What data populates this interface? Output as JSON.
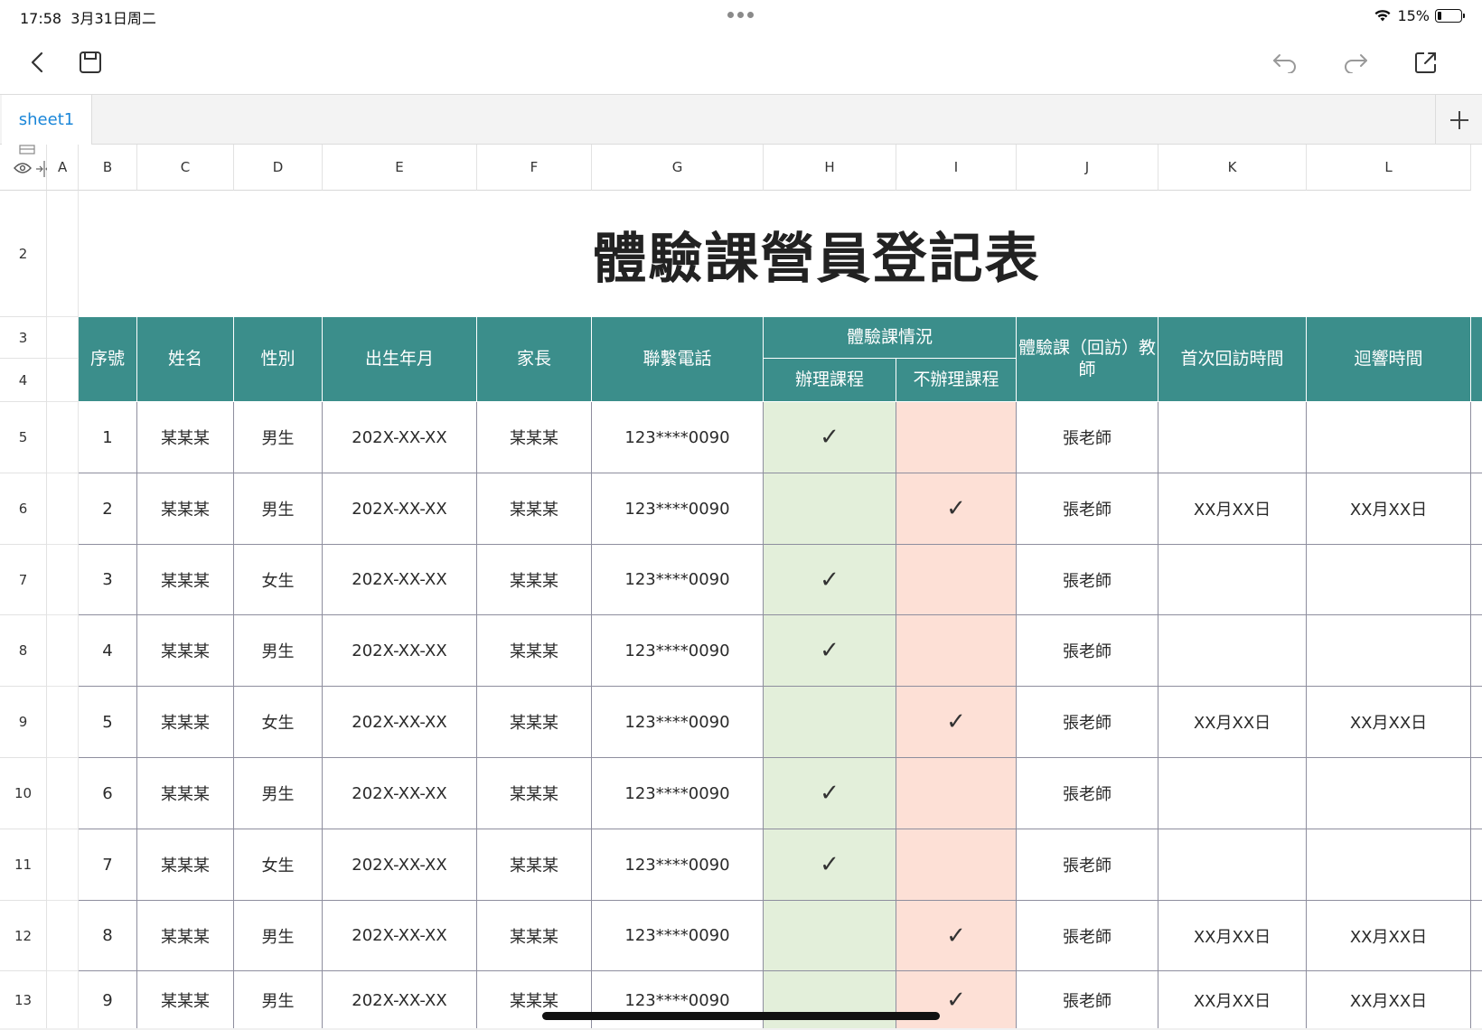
{
  "status_bar": {
    "time": "17:58",
    "date": "3月31日周二",
    "battery": "15%",
    "battery_level": 0.15
  },
  "toolbar": {
    "back_icon": "chevron-left-icon",
    "save_icon": "save-icon",
    "undo_icon": "undo-icon",
    "redo_icon": "redo-icon",
    "share_icon": "share-icon"
  },
  "sheet_tabs": [
    {
      "label": "sheet1",
      "active": true
    }
  ],
  "columns": [
    "A",
    "B",
    "C",
    "D",
    "E",
    "F",
    "G",
    "H",
    "I",
    "J",
    "K",
    "L"
  ],
  "rows": [
    "2",
    "3",
    "4",
    "5",
    "6",
    "7",
    "8",
    "9",
    "10",
    "11",
    "12",
    "13"
  ],
  "sheet": {
    "title": "體驗課營員登記表",
    "headers": {
      "seq": "序號",
      "name": "姓名",
      "gender": "性別",
      "birth": "出生年月",
      "parent": "家長",
      "phone": "聯繫電話",
      "trial_status": "體驗課情況",
      "enrolled": "辦理課程",
      "not_enrolled": "不辦理課程",
      "teacher": "體驗課（回訪）教師",
      "first_visit": "首次回訪時間",
      "response": "迴響時間"
    },
    "check_mark": "✓",
    "records": [
      {
        "seq": "1",
        "name": "某某某",
        "gender": "男生",
        "birth": "202X-XX-XX",
        "parent": "某某某",
        "phone": "123****0090",
        "enrolled": true,
        "teacher": "張老師",
        "first_visit": "",
        "response": ""
      },
      {
        "seq": "2",
        "name": "某某某",
        "gender": "男生",
        "birth": "202X-XX-XX",
        "parent": "某某某",
        "phone": "123****0090",
        "enrolled": false,
        "teacher": "張老師",
        "first_visit": "XX月XX日",
        "response": "XX月XX日"
      },
      {
        "seq": "3",
        "name": "某某某",
        "gender": "女生",
        "birth": "202X-XX-XX",
        "parent": "某某某",
        "phone": "123****0090",
        "enrolled": true,
        "teacher": "張老師",
        "first_visit": "",
        "response": ""
      },
      {
        "seq": "4",
        "name": "某某某",
        "gender": "男生",
        "birth": "202X-XX-XX",
        "parent": "某某某",
        "phone": "123****0090",
        "enrolled": true,
        "teacher": "張老師",
        "first_visit": "",
        "response": ""
      },
      {
        "seq": "5",
        "name": "某某某",
        "gender": "女生",
        "birth": "202X-XX-XX",
        "parent": "某某某",
        "phone": "123****0090",
        "enrolled": false,
        "teacher": "張老師",
        "first_visit": "XX月XX日",
        "response": "XX月XX日"
      },
      {
        "seq": "6",
        "name": "某某某",
        "gender": "男生",
        "birth": "202X-XX-XX",
        "parent": "某某某",
        "phone": "123****0090",
        "enrolled": true,
        "teacher": "張老師",
        "first_visit": "",
        "response": ""
      },
      {
        "seq": "7",
        "name": "某某某",
        "gender": "女生",
        "birth": "202X-XX-XX",
        "parent": "某某某",
        "phone": "123****0090",
        "enrolled": true,
        "teacher": "張老師",
        "first_visit": "",
        "response": ""
      },
      {
        "seq": "8",
        "name": "某某某",
        "gender": "男生",
        "birth": "202X-XX-XX",
        "parent": "某某某",
        "phone": "123****0090",
        "enrolled": false,
        "teacher": "張老師",
        "first_visit": "XX月XX日",
        "response": "XX月XX日"
      },
      {
        "seq": "9",
        "name": "某某某",
        "gender": "男生",
        "birth": "202X-XX-XX",
        "parent": "某某某",
        "phone": "123****0090",
        "enrolled": false,
        "teacher": "張老師",
        "first_visit": "XX月XX日",
        "response": "XX月XX日"
      }
    ]
  },
  "colors": {
    "header_teal": "#3b8e8b",
    "enrolled_green": "#e3efda",
    "not_enrolled_pink": "#fde0d6",
    "tab_blue": "#1a86d8"
  }
}
